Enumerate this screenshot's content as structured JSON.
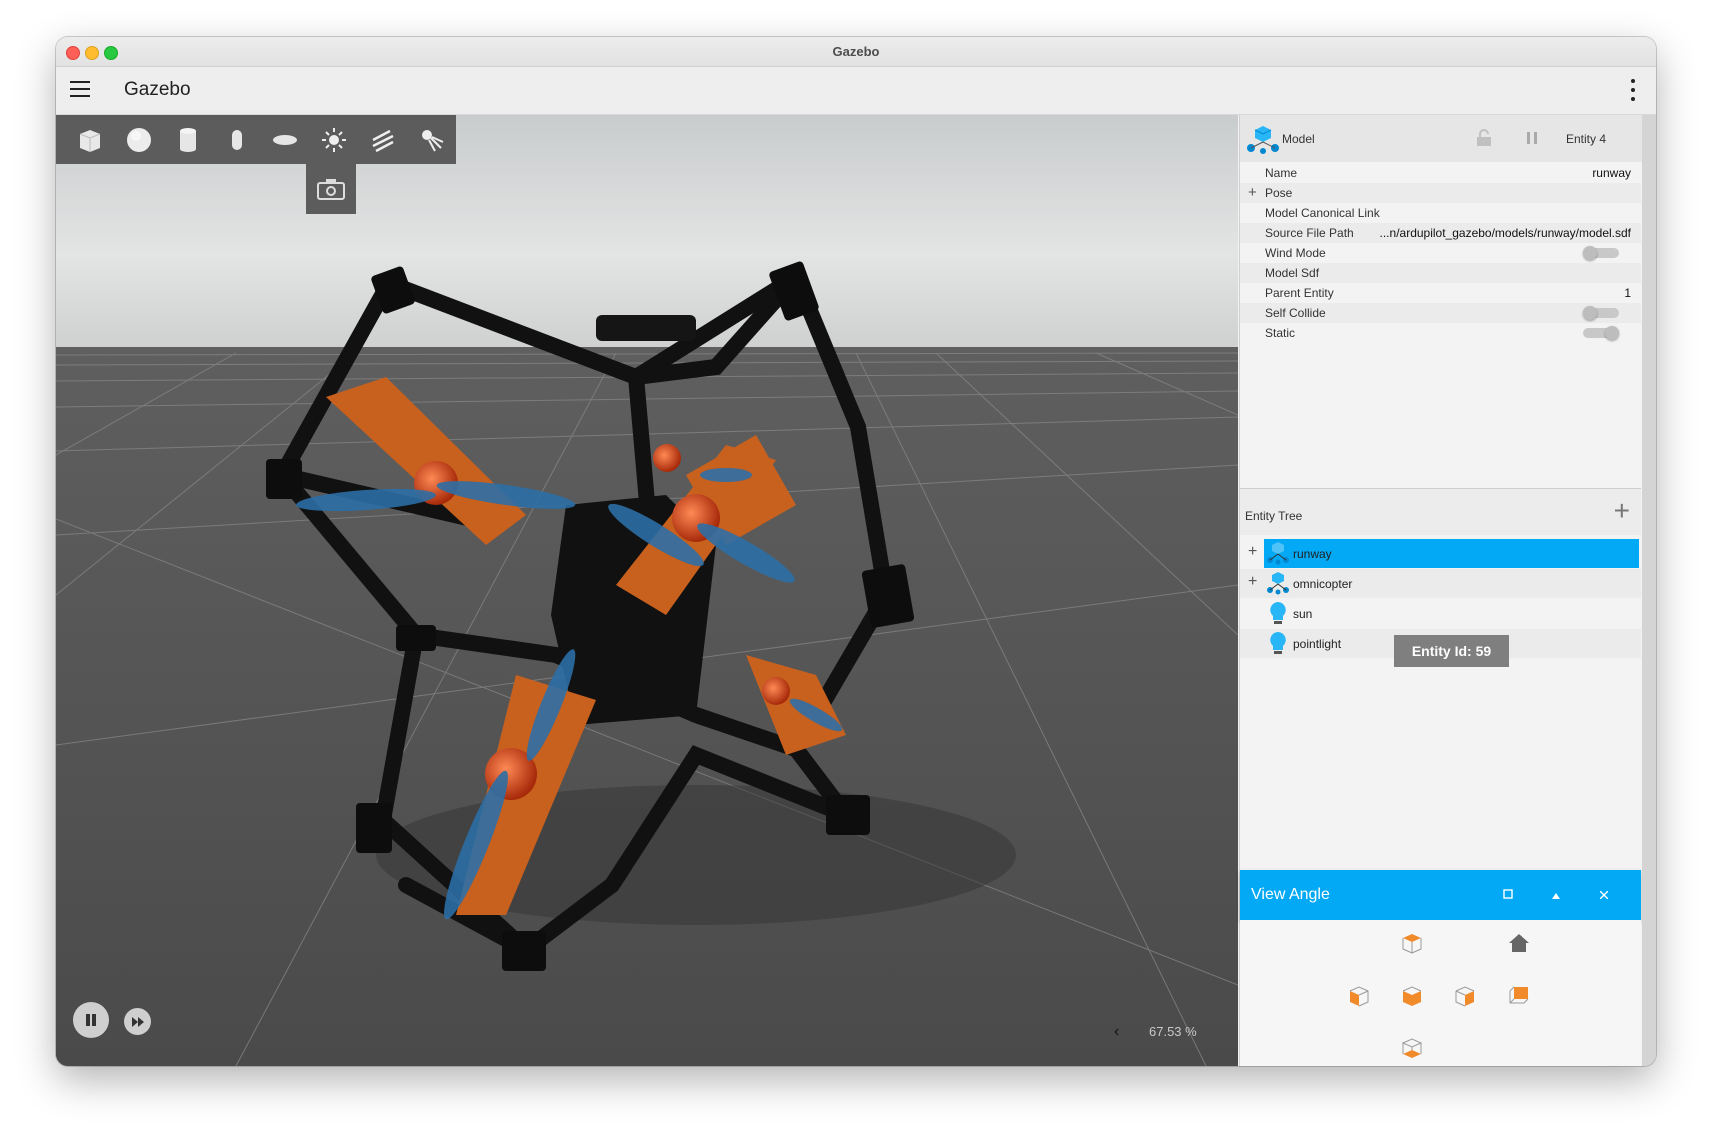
{
  "window": {
    "title": "Gazebo"
  },
  "appbar": {
    "title": "Gazebo",
    "menu_icon": "hamburger-menu-icon",
    "more_icon": "more-vert-icon"
  },
  "shape_toolbar": {
    "tools": [
      {
        "name": "box",
        "icon": "box-icon"
      },
      {
        "name": "sphere",
        "icon": "sphere-icon"
      },
      {
        "name": "cylinder",
        "icon": "cylinder-icon"
      },
      {
        "name": "capsule",
        "icon": "capsule-icon"
      },
      {
        "name": "ellipsoid",
        "icon": "ellipsoid-icon"
      },
      {
        "name": "point-light",
        "icon": "point-light-icon"
      },
      {
        "name": "directional-light",
        "icon": "directional-light-icon"
      },
      {
        "name": "spot-light",
        "icon": "spot-light-icon"
      }
    ],
    "screenshot_icon": "camera-icon"
  },
  "playback": {
    "play_pause_icon": "pause-icon",
    "step_icon": "fast-forward-icon",
    "rtf_chevron": "‹",
    "real_time_factor": "67.53 %"
  },
  "component_inspector": {
    "type": "Model",
    "entity": "Entity 4",
    "properties": [
      {
        "label": "Name",
        "value": "runway",
        "kind": "text"
      },
      {
        "label": "Pose",
        "value": "",
        "kind": "expand"
      },
      {
        "label": "Model Canonical Link",
        "value": "",
        "kind": "text"
      },
      {
        "label": "Source File Path",
        "value": "...n/ardupilot_gazebo/models/runway/model.sdf",
        "kind": "text"
      },
      {
        "label": "Wind Mode",
        "value": "",
        "kind": "toggle",
        "on": false
      },
      {
        "label": "Model Sdf",
        "value": "",
        "kind": "text"
      },
      {
        "label": "Parent Entity",
        "value": "1",
        "kind": "text"
      },
      {
        "label": "Self Collide",
        "value": "",
        "kind": "toggle",
        "on": false
      },
      {
        "label": "Static",
        "value": "",
        "kind": "toggle",
        "on": true
      }
    ]
  },
  "entity_tree": {
    "title": "Entity Tree",
    "add_label": "+",
    "items": [
      {
        "label": "runway",
        "icon": "model-icon",
        "expandable": true,
        "selected": true
      },
      {
        "label": "omnicopter",
        "icon": "model-icon",
        "expandable": true,
        "selected": false
      },
      {
        "label": "sun",
        "icon": "light-bulb-icon",
        "expandable": false,
        "selected": false
      },
      {
        "label": "pointlight",
        "icon": "light-bulb-icon",
        "expandable": false,
        "selected": false
      }
    ],
    "tooltip": "Entity Id: 59"
  },
  "view_angle": {
    "title": "View Angle",
    "buttons": [
      {
        "name": "top-view",
        "icon": "cube-top-icon"
      },
      {
        "name": "home-view",
        "icon": "home-icon"
      },
      {
        "name": "left-view",
        "icon": "cube-left-icon"
      },
      {
        "name": "front-view",
        "icon": "cube-front-icon"
      },
      {
        "name": "right-view",
        "icon": "cube-right-icon"
      },
      {
        "name": "back-view",
        "icon": "cube-back-icon"
      },
      {
        "name": "bottom-view",
        "icon": "cube-bottom-icon"
      }
    ],
    "header_controls": [
      "restore-icon",
      "collapse-icon",
      "close-icon"
    ]
  },
  "colors": {
    "accent": "#03a9f4",
    "arm_orange": "#c8601e",
    "frame_black": "#111111",
    "propeller_blue": "#2d6fa6",
    "ground": "#4a4a4a",
    "sky": "#dadada"
  }
}
